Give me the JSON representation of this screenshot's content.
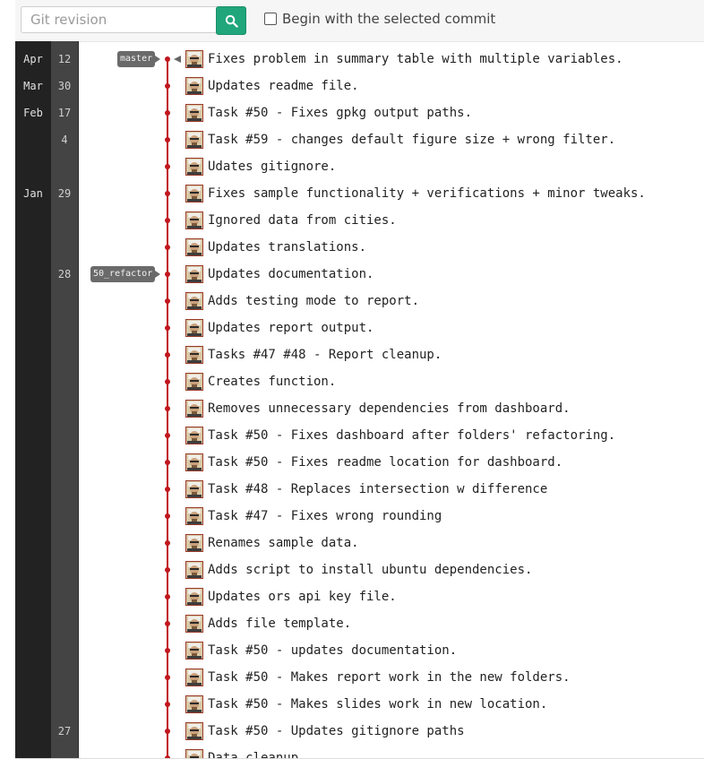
{
  "toolbar": {
    "revision_placeholder": "Git revision",
    "search_icon": "search-icon",
    "begin_label": "Begin with the selected commit",
    "accent": "#20a67a"
  },
  "graph_color": "#c0171d",
  "dates": [
    {
      "month": "Apr",
      "day": "12",
      "row": 0
    },
    {
      "month": "Mar",
      "day": "30",
      "row": 1
    },
    {
      "month": "Feb",
      "day": "17",
      "row": 2
    },
    {
      "month": "",
      "day": "4",
      "row": 3
    },
    {
      "month": "Jan",
      "day": "29",
      "row": 5
    },
    {
      "month": "",
      "day": "28",
      "row": 8
    },
    {
      "month": "",
      "day": "27",
      "row": 25
    }
  ],
  "branches": [
    {
      "name": "master",
      "row": 0,
      "head": true
    },
    {
      "name": "50_refactor",
      "row": 8,
      "head": false
    }
  ],
  "commits": [
    "Fixes problem in summary table with multiple variables.",
    "Updates readme file.",
    "Task #50 - Fixes gpkg output paths.",
    "Task #59 - changes default figure size + wrong filter.",
    "Udates gitignore.",
    "Fixes sample functionality + verifications + minor tweaks.",
    "Ignored data from cities.",
    "Updates translations.",
    "Updates documentation.",
    "Adds testing mode to report.",
    "Updates report output.",
    "Tasks #47 #48 - Report cleanup.",
    "Creates function.",
    "Removes unnecessary dependencies from dashboard.",
    "Task #50 - Fixes dashboard after folders' refactoring.",
    "Task #50 - Fixes readme location for dashboard.",
    "Task #48 - Replaces intersection w difference",
    "Task #47 - Fixes wrong rounding",
    "Renames sample data.",
    "Adds script to install ubuntu dependencies.",
    "Updates ors api key file.",
    "Adds file template.",
    "Task #50 - updates documentation.",
    "Task #50 - Makes report work in the new folders.",
    "Task #50 - Makes slides work in new location.",
    "Task #50 - Updates gitignore paths",
    "Data cleanup."
  ]
}
